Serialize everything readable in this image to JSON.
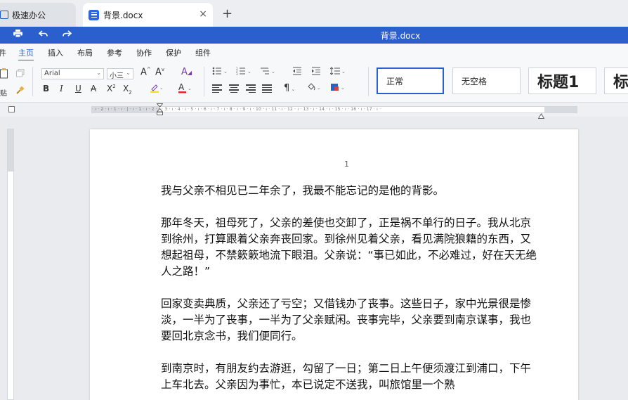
{
  "tabs": {
    "home": "极速办公",
    "doc": "背景.docx",
    "close_glyph": "×",
    "add_glyph": "+"
  },
  "titlebar": {
    "title": "背景.docx"
  },
  "menu": [
    "件",
    "主页",
    "插入",
    "布局",
    "参考",
    "协作",
    "保护",
    "组件"
  ],
  "ribbon": {
    "font_name": "Arial",
    "font_size": "小三",
    "paste_label": "贴",
    "styles": [
      "正常",
      "无空格",
      "标题1",
      "标"
    ]
  },
  "ruler_marks": "· ı · 2 · ı · 1 · ı · | · ı · 1 · ı · 2 · ı · 3 · ı · 4 · ı · 5 · ı · 6 · ı · 7 · ı · 8 · ı · 9 · ı · 10 · ı · 11 · ı · 12 · ı · 13 · ı · 14 · ı · 15 · ı · 16 · ı · 17 · ı ·",
  "document": {
    "page_number": "1",
    "paragraphs": [
      "我与父亲不相见已二年余了，我最不能忘记的是他的背影。",
      "那年冬天，祖母死了，父亲的差使也交卸了，正是祸不单行的日子。我从北京到徐州，打算跟着父亲奔丧回家。到徐州见着父亲，看见满院狼籍的东西，又想起祖母，不禁簌簌地流下眼泪。父亲说：“事已如此，不必难过，好在天无绝人之路！”",
      "回家变卖典质，父亲还了亏空；又借钱办了丧事。这些日子，家中光景很是惨淡，一半为了丧事，一半为了父亲赋闲。丧事完毕，父亲要到南京谋事，我也要回北京念书，我们便同行。",
      "到南京时，有朋友约去游逛，勾留了一日；第二日上午便须渡江到浦口，下午上车北去。父亲因为事忙，本已说定不送我，叫旅馆里一个熟"
    ]
  },
  "colors": {
    "accent": "#2c5fce"
  }
}
